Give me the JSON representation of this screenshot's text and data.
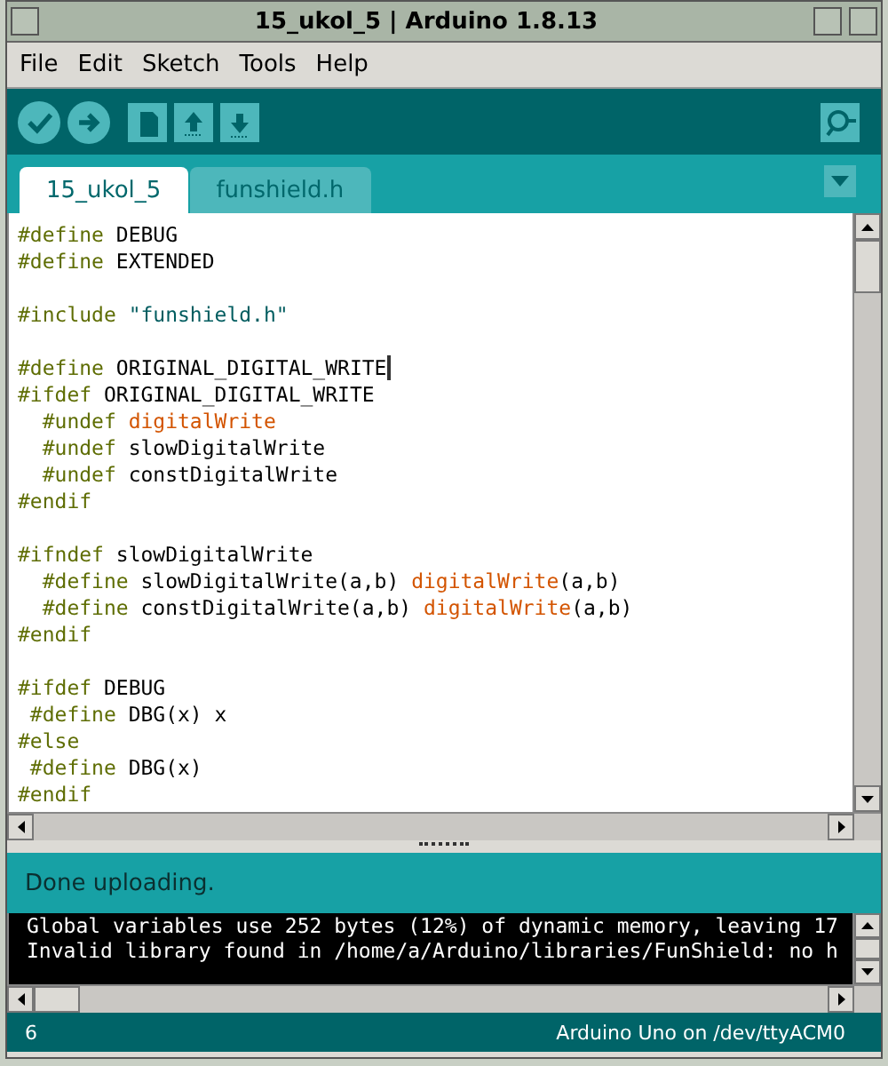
{
  "window": {
    "title": "15_ukol_5 | Arduino 1.8.13"
  },
  "menu": [
    "File",
    "Edit",
    "Sketch",
    "Tools",
    "Help"
  ],
  "toolbar": [
    {
      "kind": "verify"
    },
    {
      "kind": "upload"
    },
    {
      "kind": "new"
    },
    {
      "kind": "open"
    },
    {
      "kind": "save"
    }
  ],
  "tabs": [
    {
      "label": "15_ukol_5",
      "selected": true
    },
    {
      "label": "funshield.h",
      "selected": false
    }
  ],
  "code": [
    {
      "kind": "code",
      "segments": [
        {
          "kind": "keyword",
          "text": "#define"
        },
        {
          "kind": "plain",
          "text": " DEBUG"
        }
      ]
    },
    {
      "kind": "code",
      "segments": [
        {
          "kind": "keyword",
          "text": "#define"
        },
        {
          "kind": "plain",
          "text": " EXTENDED"
        }
      ]
    },
    {
      "kind": "blank"
    },
    {
      "kind": "code",
      "segments": [
        {
          "kind": "keyword",
          "text": "#include"
        },
        {
          "kind": "string",
          "text": " \"funshield.h\""
        }
      ]
    },
    {
      "kind": "blank"
    },
    {
      "kind": "code",
      "segments": [
        {
          "kind": "keyword",
          "text": "#define"
        },
        {
          "kind": "plain",
          "text": " ORIGINAL_DIGITAL_WRITE"
        },
        {
          "kind": "cursor"
        }
      ]
    },
    {
      "kind": "code",
      "segments": [
        {
          "kind": "keyword",
          "text": "#ifdef"
        },
        {
          "kind": "plain",
          "text": " ORIGINAL_DIGITAL_WRITE"
        }
      ]
    },
    {
      "kind": "code",
      "segments": [
        {
          "kind": "keyword",
          "text": "  #undef"
        },
        {
          "kind": "function",
          "text": " digitalWrite"
        }
      ]
    },
    {
      "kind": "code",
      "segments": [
        {
          "kind": "keyword",
          "text": "  #undef"
        },
        {
          "kind": "plain",
          "text": " slowDigitalWrite"
        }
      ]
    },
    {
      "kind": "code",
      "segments": [
        {
          "kind": "keyword",
          "text": "  #undef"
        },
        {
          "kind": "plain",
          "text": " constDigitalWrite"
        }
      ]
    },
    {
      "kind": "code",
      "segments": [
        {
          "kind": "keyword",
          "text": "#endif"
        }
      ]
    },
    {
      "kind": "blank"
    },
    {
      "kind": "code",
      "segments": [
        {
          "kind": "keyword",
          "text": "#ifndef"
        },
        {
          "kind": "plain",
          "text": " slowDigitalWrite"
        }
      ]
    },
    {
      "kind": "code",
      "segments": [
        {
          "kind": "keyword",
          "text": "  #define"
        },
        {
          "kind": "plain",
          "text": " slowDigitalWrite(a,b)"
        },
        {
          "kind": "function",
          "text": " digitalWrite"
        },
        {
          "kind": "plain",
          "text": "(a,b)"
        }
      ]
    },
    {
      "kind": "code",
      "segments": [
        {
          "kind": "keyword",
          "text": "  #define"
        },
        {
          "kind": "plain",
          "text": " constDigitalWrite(a,b)"
        },
        {
          "kind": "function",
          "text": " digitalWrite"
        },
        {
          "kind": "plain",
          "text": "(a,b)"
        }
      ]
    },
    {
      "kind": "code",
      "segments": [
        {
          "kind": "keyword",
          "text": "#endif"
        }
      ]
    },
    {
      "kind": "blank"
    },
    {
      "kind": "code",
      "segments": [
        {
          "kind": "keyword",
          "text": "#ifdef"
        },
        {
          "kind": "plain",
          "text": " DEBUG"
        }
      ]
    },
    {
      "kind": "code",
      "segments": [
        {
          "kind": "keyword",
          "text": " #define"
        },
        {
          "kind": "plain",
          "text": " DBG(x) x"
        }
      ]
    },
    {
      "kind": "code",
      "segments": [
        {
          "kind": "keyword",
          "text": "#else"
        }
      ]
    },
    {
      "kind": "code",
      "segments": [
        {
          "kind": "keyword",
          "text": " #define"
        },
        {
          "kind": "plain",
          "text": " DBG(x)"
        }
      ]
    },
    {
      "kind": "code",
      "segments": [
        {
          "kind": "keyword",
          "text": "#endif"
        }
      ]
    }
  ],
  "status": "Done uploading.",
  "console": [
    "Global variables use 252 bytes (12%) of dynamic memory, leaving 17",
    "Invalid library found in /home/a/Arduino/libraries/FunShield: no h"
  ],
  "footer": {
    "line": "6",
    "board": "Arduino Uno on /dev/ttyACM0"
  }
}
